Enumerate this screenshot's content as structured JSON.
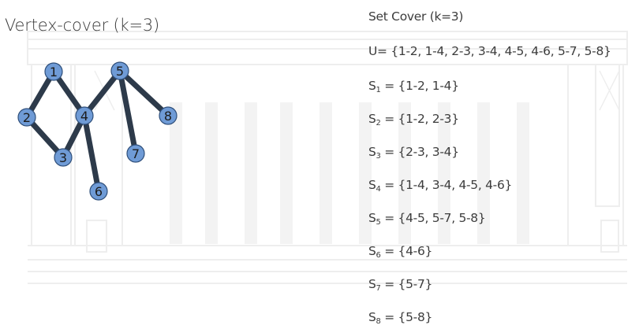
{
  "vertex_cover": {
    "title": "Vertex-cover (k=3)",
    "nodes": [
      {
        "id": "1",
        "label": "1"
      },
      {
        "id": "2",
        "label": "2"
      },
      {
        "id": "3",
        "label": "3"
      },
      {
        "id": "4",
        "label": "4"
      },
      {
        "id": "5",
        "label": "5"
      },
      {
        "id": "6",
        "label": "6"
      },
      {
        "id": "7",
        "label": "7"
      },
      {
        "id": "8",
        "label": "8"
      }
    ],
    "edges": [
      [
        "1",
        "2"
      ],
      [
        "1",
        "4"
      ],
      [
        "2",
        "3"
      ],
      [
        "3",
        "4"
      ],
      [
        "4",
        "5"
      ],
      [
        "4",
        "6"
      ],
      [
        "5",
        "7"
      ],
      [
        "5",
        "8"
      ]
    ],
    "colors": {
      "node_fill": "#6f9bd6",
      "node_stroke": "#2f4f7a",
      "edge": "#2d3a4a"
    }
  },
  "set_cover": {
    "title": "Set Cover (k=3)",
    "universe_label": "U= {1-2, 1-4, 2-3, 3-4, 4-5, 4-6, 5-7, 5-8}",
    "sets": [
      {
        "name": "S",
        "sub": "1",
        "value": " = {1-2, 1-4}"
      },
      {
        "name": "S",
        "sub": "2",
        "value": " = {1-2, 2-3}"
      },
      {
        "name": "S",
        "sub": "3",
        "value": " = {2-3, 3-4}"
      },
      {
        "name": "S",
        "sub": "4",
        "value": " = {1-4, 3-4, 4-5, 4-6}"
      },
      {
        "name": "S",
        "sub": "5",
        "value": " = {4-5, 5-7, 5-8}"
      },
      {
        "name": "S",
        "sub": "6",
        "value": " = {4-6}"
      },
      {
        "name": "S",
        "sub": "7",
        "value": " = {5-7}"
      },
      {
        "name": "S",
        "sub": "8",
        "value": " = {5-8}"
      }
    ]
  }
}
